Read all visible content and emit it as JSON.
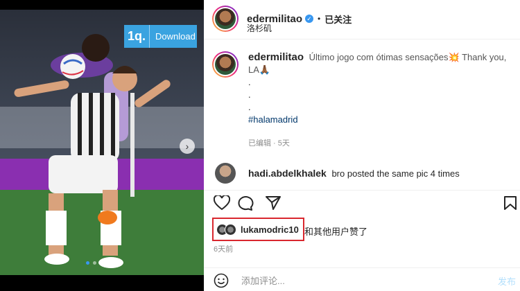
{
  "media": {
    "download_logo": "1q.",
    "download_label": "Download",
    "next_icon": "chevron-right-icon",
    "carousel": {
      "count": 5,
      "active": 1
    }
  },
  "post": {
    "username": "edermilitao",
    "follow_label": "已关注",
    "separator": "•",
    "location": "洛杉矶",
    "caption_username": "edermilitao",
    "caption": "Último jogo com ótimas sensações💥 Thank you, LA🙏🏾",
    "caption_dots": [
      ".",
      ".",
      "."
    ],
    "hashtag": "#halamadrid",
    "edited_meta": "已编辑 · 5天"
  },
  "comment": {
    "username": "hadi.abdelkhalek",
    "text": "bro posted the same pic 4 times"
  },
  "likes": {
    "user": "lukamodric10",
    "rest": "和其他用户赞了",
    "time_ago": "6天前"
  },
  "comment_box": {
    "placeholder": "添加评论...",
    "post_label": "发布"
  },
  "colors": {
    "accent": "#3897f0",
    "highlight_border": "#d9272e",
    "download_bg": "#3aa3e0"
  }
}
